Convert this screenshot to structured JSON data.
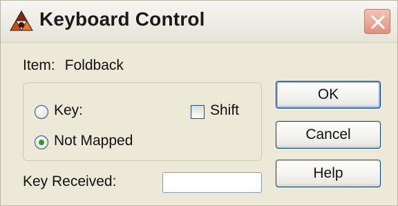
{
  "window": {
    "title": "Keyboard Control",
    "app_icon": "reason-app-icon",
    "close_icon": "close-icon"
  },
  "item": {
    "label": "Item:",
    "value": "Foldback"
  },
  "mapping": {
    "key_label": "Key:",
    "not_mapped_label": "Not Mapped",
    "selected": "not_mapped",
    "shift_label": "Shift",
    "shift_checked": false
  },
  "key_received": {
    "label": "Key Received:",
    "value": ""
  },
  "buttons": {
    "ok": "OK",
    "cancel": "Cancel",
    "help": "Help"
  },
  "colors": {
    "accent_radio": "#21a121",
    "button_border": "#003c74",
    "close_button": "#e0907c"
  }
}
